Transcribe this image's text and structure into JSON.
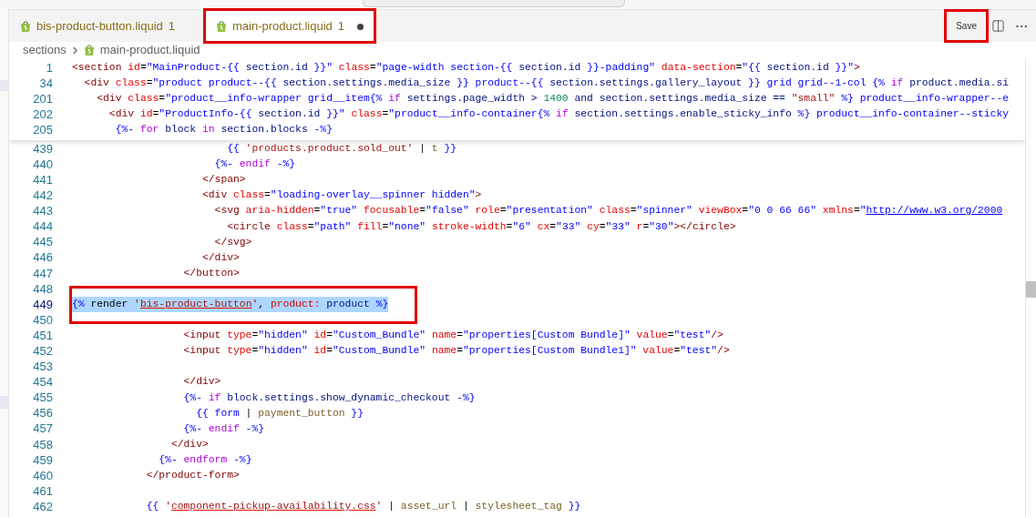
{
  "tabs": [
    {
      "label": "bis-product-button.liquid",
      "problems": "1",
      "selected": false,
      "dirty": false,
      "annotated": false
    },
    {
      "label": "main-product.liquid",
      "problems": "1",
      "selected": true,
      "dirty": true,
      "annotated": true
    }
  ],
  "save_button": {
    "label": "Save",
    "annotated": true
  },
  "breadcrumb": {
    "folder": "sections",
    "file": "main-product.liquid"
  },
  "sticky_lines": [
    {
      "number": "1",
      "tokens": [
        {
          "kind": "tag",
          "text": "<section"
        },
        {
          "kind": "attr",
          "text": " id"
        },
        {
          "kind": "plain",
          "text": "="
        },
        {
          "kind": "str",
          "text": "\"MainProduct-"
        },
        {
          "kind": "lq",
          "text": "{{ "
        },
        {
          "kind": "var",
          "text": "section.id"
        },
        {
          "kind": "lq",
          "text": " }}"
        },
        {
          "kind": "str",
          "text": "\""
        },
        {
          "kind": "attr",
          "text": " class"
        },
        {
          "kind": "plain",
          "text": "="
        },
        {
          "kind": "str",
          "text": "\"page-width section-"
        },
        {
          "kind": "lq",
          "text": "{{ "
        },
        {
          "kind": "var",
          "text": "section.id"
        },
        {
          "kind": "lq",
          "text": " }}"
        },
        {
          "kind": "str",
          "text": "-padding\""
        },
        {
          "kind": "attr",
          "text": " data-section"
        },
        {
          "kind": "plain",
          "text": "="
        },
        {
          "kind": "str",
          "text": "\""
        },
        {
          "kind": "lq",
          "text": "{{ "
        },
        {
          "kind": "var",
          "text": "section.id"
        },
        {
          "kind": "lq",
          "text": " }}"
        },
        {
          "kind": "str",
          "text": "\""
        },
        {
          "kind": "tag",
          "text": ">"
        }
      ]
    },
    {
      "number": "34",
      "tokens": [
        {
          "kind": "tag",
          "text": "  <div"
        },
        {
          "kind": "attr",
          "text": " class"
        },
        {
          "kind": "plain",
          "text": "="
        },
        {
          "kind": "str",
          "text": "\"product product--"
        },
        {
          "kind": "lq",
          "text": "{{ "
        },
        {
          "kind": "var",
          "text": "section.settings.media_size"
        },
        {
          "kind": "lq",
          "text": " }}"
        },
        {
          "kind": "str",
          "text": " product--"
        },
        {
          "kind": "lq",
          "text": "{{ "
        },
        {
          "kind": "var",
          "text": "section.settings.gallery_layout"
        },
        {
          "kind": "lq",
          "text": " }}"
        },
        {
          "kind": "str",
          "text": " grid grid--1-col "
        },
        {
          "kind": "lq",
          "text": "{% "
        },
        {
          "kind": "kw",
          "text": "if"
        },
        {
          "kind": "var",
          "text": " product.media.si"
        }
      ]
    },
    {
      "number": "201",
      "tokens": [
        {
          "kind": "tag",
          "text": "    <div"
        },
        {
          "kind": "attr",
          "text": " class"
        },
        {
          "kind": "plain",
          "text": "="
        },
        {
          "kind": "str",
          "text": "\"product__info-wrapper grid__item"
        },
        {
          "kind": "lq",
          "text": "{% "
        },
        {
          "kind": "kw",
          "text": "if"
        },
        {
          "kind": "var",
          "text": " settings.page_width > "
        },
        {
          "kind": "num",
          "text": "1400"
        },
        {
          "kind": "var",
          "text": " and section.settings.media_size == "
        },
        {
          "kind": "lstr",
          "text": "\"small\""
        },
        {
          "kind": "lq",
          "text": " %}"
        },
        {
          "kind": "str",
          "text": " product__info-wrapper--e"
        }
      ]
    },
    {
      "number": "202",
      "tokens": [
        {
          "kind": "tag",
          "text": "      <div"
        },
        {
          "kind": "attr",
          "text": " id"
        },
        {
          "kind": "plain",
          "text": "="
        },
        {
          "kind": "str",
          "text": "\"ProductInfo-"
        },
        {
          "kind": "lq",
          "text": "{{ "
        },
        {
          "kind": "var",
          "text": "section.id"
        },
        {
          "kind": "lq",
          "text": " }}"
        },
        {
          "kind": "str",
          "text": "\""
        },
        {
          "kind": "attr",
          "text": " class"
        },
        {
          "kind": "plain",
          "text": "="
        },
        {
          "kind": "str",
          "text": "\"product__info-container"
        },
        {
          "kind": "lq",
          "text": "{% "
        },
        {
          "kind": "kw",
          "text": "if"
        },
        {
          "kind": "var",
          "text": " section.settings.enable_sticky_info"
        },
        {
          "kind": "lq",
          "text": " %}"
        },
        {
          "kind": "str",
          "text": " product__info-container--sticky"
        }
      ]
    },
    {
      "number": "205",
      "tokens": [
        {
          "kind": "lq",
          "text": "       {%- "
        },
        {
          "kind": "kw",
          "text": "for"
        },
        {
          "kind": "var",
          "text": " block "
        },
        {
          "kind": "kw",
          "text": "in"
        },
        {
          "kind": "var",
          "text": " section.blocks"
        },
        {
          "kind": "lq",
          "text": " -%}"
        }
      ]
    }
  ],
  "lines": [
    {
      "number": "439",
      "selected": false,
      "annotated": false,
      "tokens": [
        {
          "kind": "lq",
          "text": "                         {{ "
        },
        {
          "kind": "lstr",
          "text": "'products.product.sold_out'"
        },
        {
          "kind": "plain",
          "text": " | "
        },
        {
          "kind": "filter",
          "text": "t"
        },
        {
          "kind": "lq",
          "text": " }}"
        }
      ]
    },
    {
      "number": "440",
      "selected": false,
      "annotated": false,
      "tokens": [
        {
          "kind": "lq",
          "text": "                       {%- "
        },
        {
          "kind": "kw",
          "text": "endif"
        },
        {
          "kind": "lq",
          "text": " -%}"
        }
      ]
    },
    {
      "number": "441",
      "selected": false,
      "annotated": false,
      "tokens": [
        {
          "kind": "tag",
          "text": "                     </span>"
        }
      ]
    },
    {
      "number": "442",
      "selected": false,
      "annotated": false,
      "tokens": [
        {
          "kind": "tag",
          "text": "                     <div"
        },
        {
          "kind": "attr",
          "text": " class"
        },
        {
          "kind": "plain",
          "text": "="
        },
        {
          "kind": "str",
          "text": "\"loading-overlay__spinner hidden\""
        },
        {
          "kind": "tag",
          "text": ">"
        }
      ]
    },
    {
      "number": "443",
      "selected": false,
      "annotated": false,
      "tokens": [
        {
          "kind": "tag",
          "text": "                       <svg"
        },
        {
          "kind": "attr",
          "text": " aria-hidden"
        },
        {
          "kind": "plain",
          "text": "="
        },
        {
          "kind": "str",
          "text": "\"true\""
        },
        {
          "kind": "attr",
          "text": " focusable"
        },
        {
          "kind": "plain",
          "text": "="
        },
        {
          "kind": "str",
          "text": "\"false\""
        },
        {
          "kind": "attr",
          "text": " role"
        },
        {
          "kind": "plain",
          "text": "="
        },
        {
          "kind": "str",
          "text": "\"presentation\""
        },
        {
          "kind": "attr",
          "text": " class"
        },
        {
          "kind": "plain",
          "text": "="
        },
        {
          "kind": "str",
          "text": "\"spinner\""
        },
        {
          "kind": "attr",
          "text": " viewBox"
        },
        {
          "kind": "plain",
          "text": "="
        },
        {
          "kind": "str",
          "text": "\"0 0 66 66\""
        },
        {
          "kind": "attr",
          "text": " xmlns"
        },
        {
          "kind": "plain",
          "text": "="
        },
        {
          "kind": "str",
          "text": "\""
        },
        {
          "kind": "link",
          "text": "http://www.w3.org/2000"
        }
      ]
    },
    {
      "number": "444",
      "selected": false,
      "annotated": false,
      "tokens": [
        {
          "kind": "tag",
          "text": "                         <circle"
        },
        {
          "kind": "attr",
          "text": " class"
        },
        {
          "kind": "plain",
          "text": "="
        },
        {
          "kind": "str",
          "text": "\"path\""
        },
        {
          "kind": "attr",
          "text": " fill"
        },
        {
          "kind": "plain",
          "text": "="
        },
        {
          "kind": "str",
          "text": "\"none\""
        },
        {
          "kind": "attr",
          "text": " stroke-width"
        },
        {
          "kind": "plain",
          "text": "="
        },
        {
          "kind": "str",
          "text": "\"6\""
        },
        {
          "kind": "attr",
          "text": " cx"
        },
        {
          "kind": "plain",
          "text": "="
        },
        {
          "kind": "str",
          "text": "\"33\""
        },
        {
          "kind": "attr",
          "text": " cy"
        },
        {
          "kind": "plain",
          "text": "="
        },
        {
          "kind": "str",
          "text": "\"33\""
        },
        {
          "kind": "attr",
          "text": " r"
        },
        {
          "kind": "plain",
          "text": "="
        },
        {
          "kind": "str",
          "text": "\"30\""
        },
        {
          "kind": "tag",
          "text": "></circle>"
        }
      ]
    },
    {
      "number": "445",
      "selected": false,
      "annotated": false,
      "tokens": [
        {
          "kind": "tag",
          "text": "                       </svg>"
        }
      ]
    },
    {
      "number": "446",
      "selected": false,
      "annotated": false,
      "tokens": [
        {
          "kind": "tag",
          "text": "                     </div>"
        }
      ]
    },
    {
      "number": "447",
      "selected": false,
      "annotated": false,
      "tokens": [
        {
          "kind": "tag",
          "text": "                  </button>"
        }
      ]
    },
    {
      "number": "448",
      "selected": false,
      "annotated": false
    },
    {
      "number": "449",
      "selected": true,
      "annotated": true,
      "tokens": [
        {
          "kind": "lq",
          "text": "{% "
        },
        {
          "kind": "plain",
          "text": "render "
        },
        {
          "kind": "lstr",
          "text": "'"
        },
        {
          "kind": "ref",
          "text": "bis-product-button"
        },
        {
          "kind": "lstr",
          "text": "'"
        },
        {
          "kind": "plain",
          "text": ", "
        },
        {
          "kind": "attr",
          "text": "product:"
        },
        {
          "kind": "var",
          "text": " product"
        },
        {
          "kind": "lq",
          "text": " %}"
        }
      ]
    },
    {
      "number": "450",
      "selected": false,
      "annotated": false
    },
    {
      "number": "451",
      "selected": false,
      "annotated": false,
      "tokens": [
        {
          "kind": "tag",
          "text": "                  <input"
        },
        {
          "kind": "attr",
          "text": " type"
        },
        {
          "kind": "plain",
          "text": "="
        },
        {
          "kind": "str",
          "text": "\"hidden\""
        },
        {
          "kind": "attr",
          "text": " id"
        },
        {
          "kind": "plain",
          "text": "="
        },
        {
          "kind": "str",
          "text": "\"Custom_Bundle\""
        },
        {
          "kind": "attr",
          "text": " name"
        },
        {
          "kind": "plain",
          "text": "="
        },
        {
          "kind": "str",
          "text": "\"properties[Custom Bundle]\""
        },
        {
          "kind": "attr",
          "text": " value"
        },
        {
          "kind": "plain",
          "text": "="
        },
        {
          "kind": "str",
          "text": "\"test\""
        },
        {
          "kind": "tag",
          "text": "/>"
        }
      ]
    },
    {
      "number": "452",
      "selected": false,
      "annotated": false,
      "tokens": [
        {
          "kind": "tag",
          "text": "                  <input"
        },
        {
          "kind": "attr",
          "text": " type"
        },
        {
          "kind": "plain",
          "text": "="
        },
        {
          "kind": "str",
          "text": "\"hidden\""
        },
        {
          "kind": "attr",
          "text": " id"
        },
        {
          "kind": "plain",
          "text": "="
        },
        {
          "kind": "str",
          "text": "\"Custom_Bundle\""
        },
        {
          "kind": "attr",
          "text": " name"
        },
        {
          "kind": "plain",
          "text": "="
        },
        {
          "kind": "str",
          "text": "\"properties[Custom Bundle1]\""
        },
        {
          "kind": "attr",
          "text": " value"
        },
        {
          "kind": "plain",
          "text": "="
        },
        {
          "kind": "str",
          "text": "\"test\""
        },
        {
          "kind": "tag",
          "text": "/>"
        }
      ]
    },
    {
      "number": "453",
      "selected": false,
      "annotated": false
    },
    {
      "number": "454",
      "selected": false,
      "annotated": false,
      "tokens": [
        {
          "kind": "tag",
          "text": "                  </div>"
        }
      ]
    },
    {
      "number": "455",
      "selected": false,
      "annotated": false,
      "tokens": [
        {
          "kind": "lq",
          "text": "                  {%- "
        },
        {
          "kind": "kw",
          "text": "if"
        },
        {
          "kind": "var",
          "text": " block.settings.show_dynamic_checkout"
        },
        {
          "kind": "lq",
          "text": " -%}"
        }
      ]
    },
    {
      "number": "456",
      "selected": false,
      "annotated": false,
      "tokens": [
        {
          "kind": "lq",
          "text": "                    {{ "
        },
        {
          "kind": "str",
          "text": "form"
        },
        {
          "kind": "plain",
          "text": " | "
        },
        {
          "kind": "filter",
          "text": "payment_button"
        },
        {
          "kind": "lq",
          "text": " }}"
        }
      ]
    },
    {
      "number": "457",
      "selected": false,
      "annotated": false,
      "tokens": [
        {
          "kind": "lq",
          "text": "                  {%- "
        },
        {
          "kind": "kw",
          "text": "endif"
        },
        {
          "kind": "lq",
          "text": " -%}"
        }
      ]
    },
    {
      "number": "458",
      "selected": false,
      "annotated": false,
      "tokens": [
        {
          "kind": "tag",
          "text": "                </div>"
        }
      ]
    },
    {
      "number": "459",
      "selected": false,
      "annotated": false,
      "tokens": [
        {
          "kind": "lq",
          "text": "              {%- "
        },
        {
          "kind": "kw",
          "text": "endform"
        },
        {
          "kind": "lq",
          "text": " -%}"
        }
      ]
    },
    {
      "number": "460",
      "selected": false,
      "annotated": false,
      "tokens": [
        {
          "kind": "tag",
          "text": "            </product-form>"
        }
      ]
    },
    {
      "number": "461",
      "selected": false,
      "annotated": false
    },
    {
      "number": "462",
      "selected": false,
      "annotated": false,
      "tokens": [
        {
          "kind": "lq",
          "text": "            {{ "
        },
        {
          "kind": "lstr",
          "text": "'"
        },
        {
          "kind": "ref",
          "text": "component-pickup-availability.css"
        },
        {
          "kind": "lstr",
          "text": "'"
        },
        {
          "kind": "plain",
          "text": " | "
        },
        {
          "kind": "filter",
          "text": "asset_url"
        },
        {
          "kind": "plain",
          "text": " | "
        },
        {
          "kind": "filter",
          "text": "stylesheet_tag"
        },
        {
          "kind": "lq",
          "text": " }}"
        }
      ]
    }
  ]
}
